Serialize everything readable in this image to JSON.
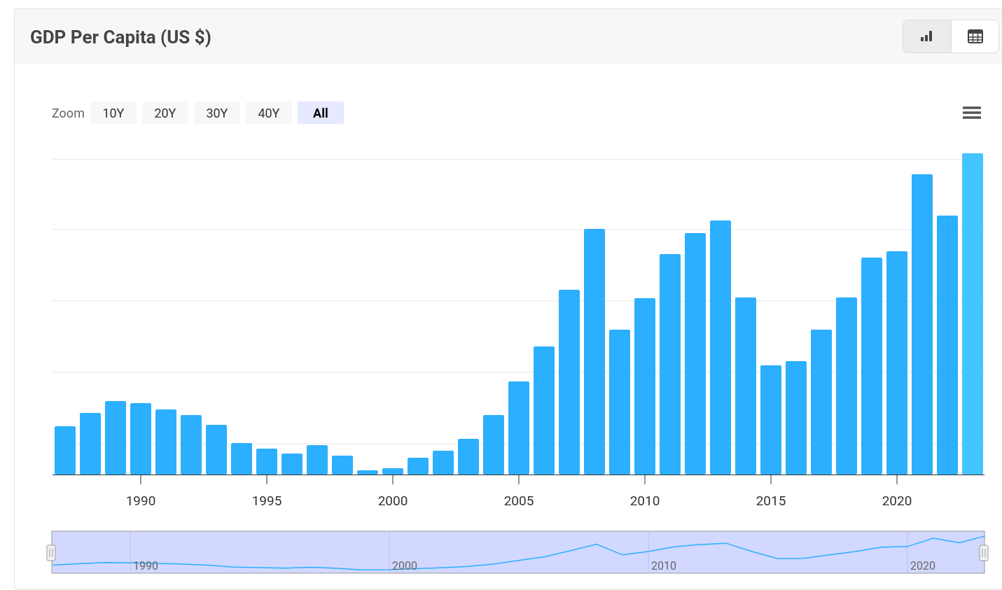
{
  "card": {
    "title": "GDP Per Capita (US $)"
  },
  "view_toggle": [
    {
      "kind": "chart",
      "selected": true
    },
    {
      "kind": "table",
      "selected": false
    }
  ],
  "zoom": {
    "label": "Zoom",
    "buttons": [
      {
        "label": "10Y",
        "selected": false
      },
      {
        "label": "20Y",
        "selected": false
      },
      {
        "label": "30Y",
        "selected": false
      },
      {
        "label": "40Y",
        "selected": false
      },
      {
        "label": "All",
        "selected": true
      }
    ]
  },
  "x_axis": {
    "labels": [
      "1990",
      "1995",
      "2000",
      "2005",
      "2010",
      "2015",
      "2020"
    ]
  },
  "navigator": {
    "labels": [
      "1990",
      "2000",
      "2010",
      "2020"
    ]
  }
}
